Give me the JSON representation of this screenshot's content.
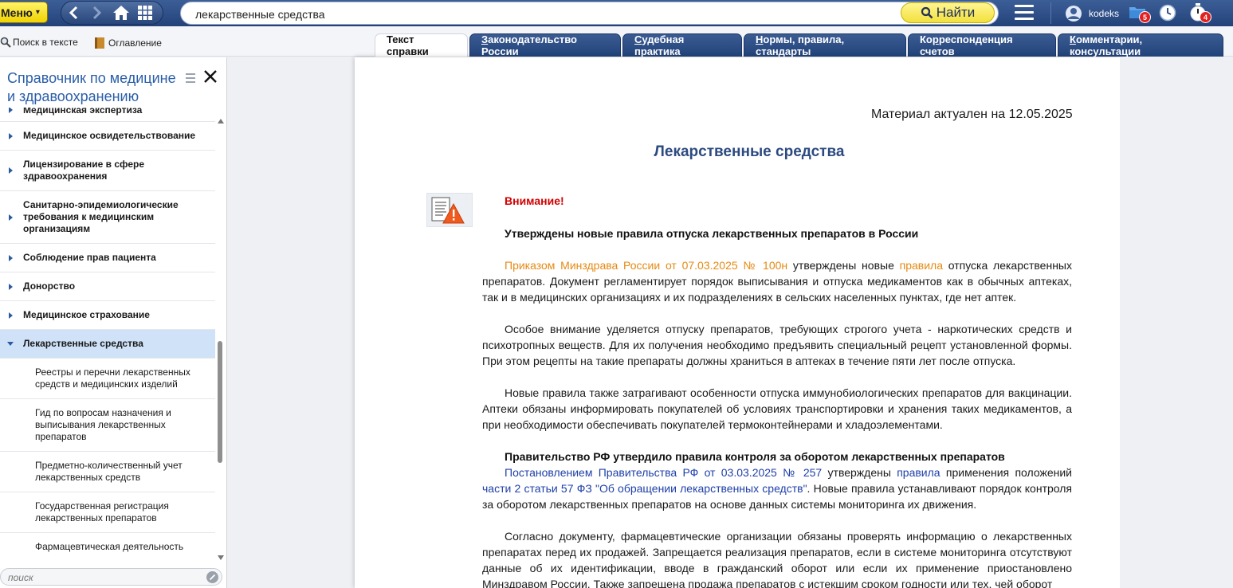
{
  "toolbar": {
    "menu_label": "Меню",
    "search_value": "лекарственные средства",
    "find_label": "Найти",
    "user_name": "kodeks",
    "folder_badge": "5",
    "timer_badge": "4"
  },
  "subbar": {
    "search_in_text": "Поиск в тексте",
    "contents": "Оглавление"
  },
  "tabs": [
    {
      "label": "Текст справки",
      "active": true
    },
    {
      "label": "Законодательство России",
      "accel": "З"
    },
    {
      "label": "Судебная практика",
      "accel": "С"
    },
    {
      "label": "Нормы, правила, стандарты",
      "accel": "Н"
    },
    {
      "label": "Корреспонденция счетов",
      "accel": "р"
    },
    {
      "label": "Комментарии, консультации",
      "accel": "К"
    }
  ],
  "sidebar": {
    "title": "Справочник по медицине и здравоохранению",
    "items": [
      {
        "label": "Медицинская экспертиза"
      },
      {
        "label": "Медицинское освидетельствование"
      },
      {
        "label": "Лицензирование в сфере здравоохранения"
      },
      {
        "label": "Санитарно-эпидемиологические требования к медицинским организациям"
      },
      {
        "label": "Соблюдение прав пациента"
      },
      {
        "label": "Донорство"
      },
      {
        "label": "Медицинское страхование"
      },
      {
        "label": "Лекарственные средства"
      }
    ],
    "subitems": [
      {
        "label": "Реестры и перечни лекарственных средств и медицинских изделий"
      },
      {
        "label": "Гид по вопросам назначения и выписывания лекарственных препаратов"
      },
      {
        "label": "Предметно-количественный учет лекарственных средств"
      },
      {
        "label": "Государственная регистрация лекарственных препаратов"
      },
      {
        "label": "Фармацевтическая деятельность"
      }
    ],
    "search_placeholder": "поиск"
  },
  "document": {
    "actual_date": "Материал актуален на 12.05.2025",
    "title": "Лекарственные средства",
    "attention": "Внимание!",
    "headline1": "Утверждены новые правила отпуска лекарственных препаратов в России",
    "p1_link1": "Приказом Минздрава России от 07.03.2025 № 100н",
    "p1_mid": " утверждены новые ",
    "p1_link2": "правила",
    "p1_rest": " отпуска лекарственных препаратов. Документ регламентирует порядок выписывания и отпуска медикаментов как в обычных аптеках, так и в медицинских организациях и их подразделениях в сельских населенных пунктах, где нет аптек.",
    "p2": "Особое внимание уделяется отпуску препаратов, требующих строгого учета - наркотических средств и психотропных веществ. Для их получения необходимо предъявить специальный рецепт установленной формы. При этом рецепты на такие препараты должны храниться в аптеках в течение пяти лет после отпуска.",
    "p3": "Новые правила также затрагивают особенности отпуска иммунобиологических препаратов для вакцинации. Аптеки обязаны информировать покупателей об условиях транспортировки и хранения таких медикаментов, а при необходимости обеспечивать покупателей термоконтейнерами и хладоэлементами.",
    "headline2": "Правительство РФ утвердило правила контроля за оборотом лекарственных препаратов",
    "p4_link1": "Постановлением Правительства РФ от 03.03.2025 № 257",
    "p4_mid": " утверждены ",
    "p4_link2": "правила",
    "p4_mid2": " применения положений ",
    "p4_link3": "части 2 статьи 57 ФЗ \"Об обращении лекарственных средств\"",
    "p4_rest": ". Новые правила устанавливают порядок контроля за оборотом лекарственных препаратов на основе данных системы мониторинга их движения.",
    "p5": "Согласно документу, фармацевтические организации обязаны проверять информацию о лекарственных препаратах перед их продажей. Запрещается реализация препаратов, если в системе мониторинга отсутствуют данные об их идентификации, вводе в гражданский оборот или если их применение приостановлено Минздравом России. Также запрещена продажа препаратов с истекшим сроком годности или тех, чей оборот"
  },
  "colors": {
    "toolbar_bg": "#23427a",
    "accent_yellow": "#f1d300",
    "link_orange": "#e58a12",
    "link_blue": "#1e3fa8",
    "title_blue": "#2c4a80",
    "sidebar_title": "#2a5ea8",
    "attention_red": "#d10000"
  }
}
